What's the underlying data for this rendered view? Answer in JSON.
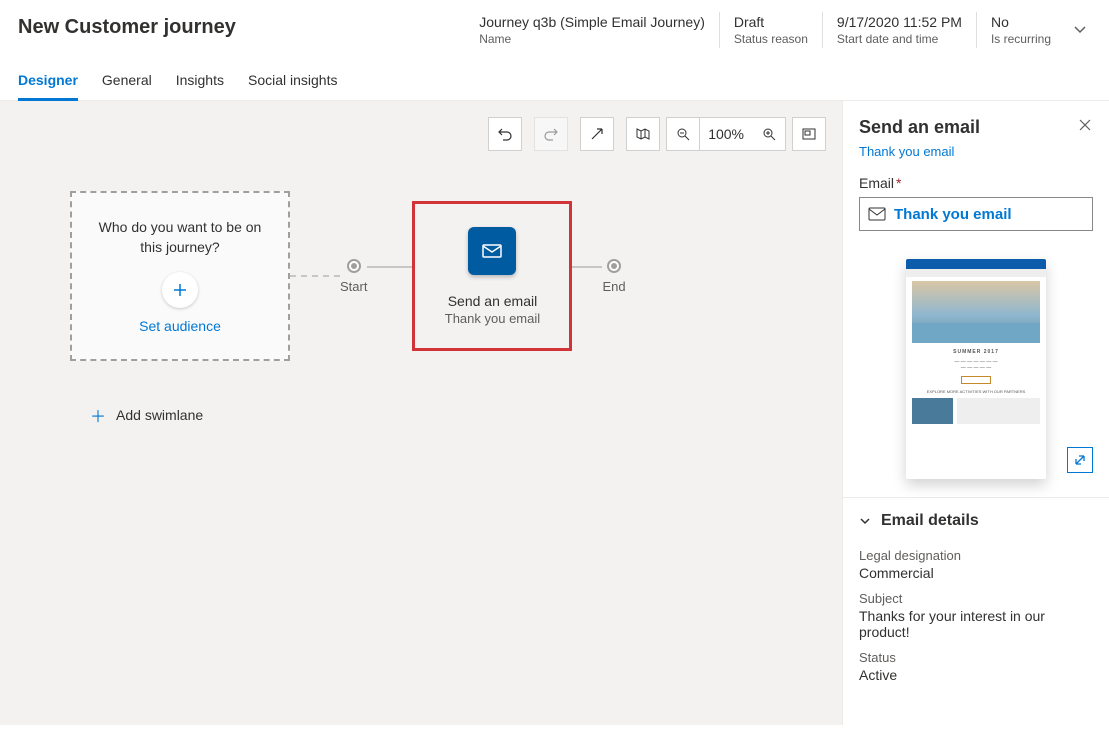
{
  "header": {
    "page_title": "New Customer journey",
    "meta": [
      {
        "value": "Journey q3b (Simple Email Journey)",
        "label": "Name"
      },
      {
        "value": "Draft",
        "label": "Status reason"
      },
      {
        "value": "9/17/2020 11:52 PM",
        "label": "Start date and time"
      },
      {
        "value": "No",
        "label": "Is recurring"
      }
    ]
  },
  "tabs": {
    "items": [
      "Designer",
      "General",
      "Insights",
      "Social insights"
    ],
    "active_index": 0
  },
  "toolbar": {
    "zoom_label": "100%",
    "icons": {
      "undo": "undo-icon",
      "redo": "redo-icon",
      "fit": "fit-screen-icon",
      "map": "minimap-icon",
      "zoom_out": "zoom-out-icon",
      "zoom_in": "zoom-in-icon",
      "fullscreen": "fullscreen-icon"
    }
  },
  "canvas": {
    "audience_question": "Who do you want to be on this journey?",
    "set_audience_label": "Set audience",
    "start_label": "Start",
    "end_label": "End",
    "email_tile": {
      "title": "Send an email",
      "subtitle": "Thank you email"
    },
    "add_swimlane_label": "Add swimlane"
  },
  "side_panel": {
    "title": "Send an email",
    "subtitle_link": "Thank you email",
    "email_field_label": "Email",
    "email_field_value": "Thank you email",
    "accordion_title": "Email details",
    "details": {
      "legal_label": "Legal designation",
      "legal_value": "Commercial",
      "subject_label": "Subject",
      "subject_value": "Thanks for your interest in our product!",
      "status_label": "Status",
      "status_value": "Active"
    },
    "preview": {
      "headline": "SUMMER 2017"
    }
  }
}
